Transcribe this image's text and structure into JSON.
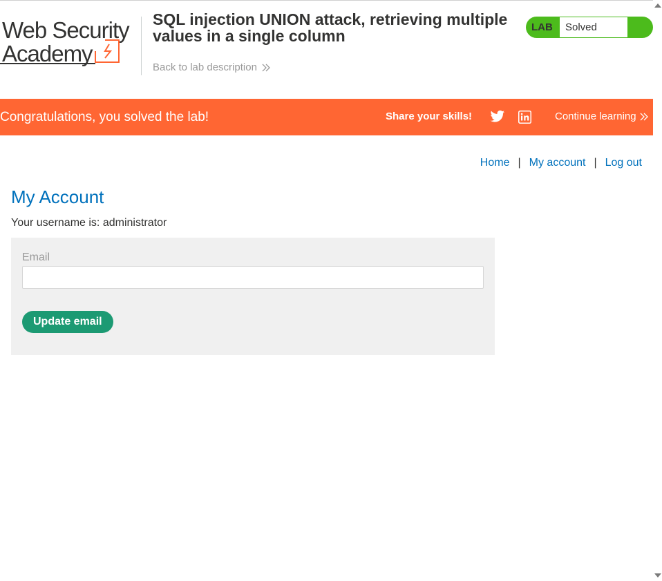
{
  "header": {
    "logo_line1": "Web Security",
    "logo_line2": "Academy",
    "lab_title": "SQL injection UNION attack, retrieving multiple values in a single column",
    "back_link": "Back to lab description",
    "status_tag": "LAB",
    "status_text": "Solved",
    "status_color": "#4cbb1c"
  },
  "banner": {
    "message": "Congratulations, you solved the lab!",
    "share_label": "Share your skills!",
    "continue_label": "Continue learning",
    "color": "#ff6633"
  },
  "nav": {
    "home": "Home",
    "account": "My account",
    "logout": "Log out",
    "separator": "|"
  },
  "account": {
    "title": "My Account",
    "username_line": "Your username is: administrator",
    "email_label": "Email",
    "email_value": "",
    "update_button": "Update email"
  }
}
